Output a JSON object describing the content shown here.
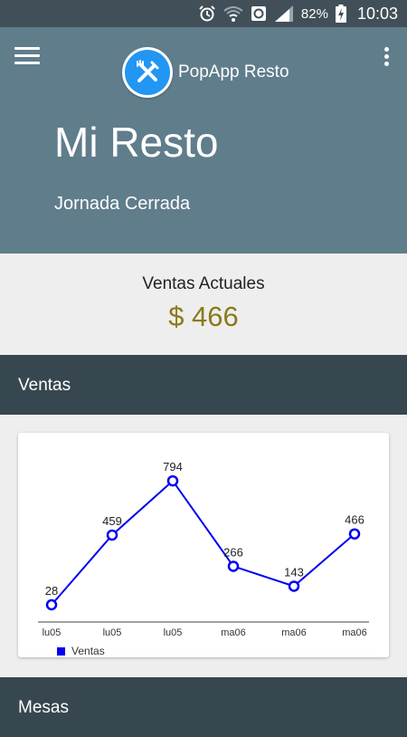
{
  "status_bar": {
    "battery_percent": "82%",
    "time": "10:03",
    "icons": [
      "alarm-icon",
      "wifi-icon",
      "sync-icon",
      "signal-icon",
      "battery-icon"
    ]
  },
  "header": {
    "app_name": "PopApp Resto",
    "title": "Mi Resto",
    "subtitle": "Jornada Cerrada",
    "color": "#607d8b"
  },
  "ventas_actuales": {
    "label": "Ventas Actuales",
    "amount": "$ 466",
    "amount_color": "#8a7a1a"
  },
  "sections": {
    "ventas": "Ventas",
    "mesas": "Mesas"
  },
  "chart_data": {
    "type": "line",
    "categories": [
      "lu05",
      "lu05",
      "lu05",
      "ma06",
      "ma06",
      "ma06"
    ],
    "series": [
      {
        "name": "Ventas",
        "values": [
          28,
          459,
          794,
          266,
          143,
          466
        ],
        "color": "#0000ee"
      }
    ],
    "ylim": [
      0,
      800
    ],
    "grid": false,
    "legend": "bottom-left"
  }
}
